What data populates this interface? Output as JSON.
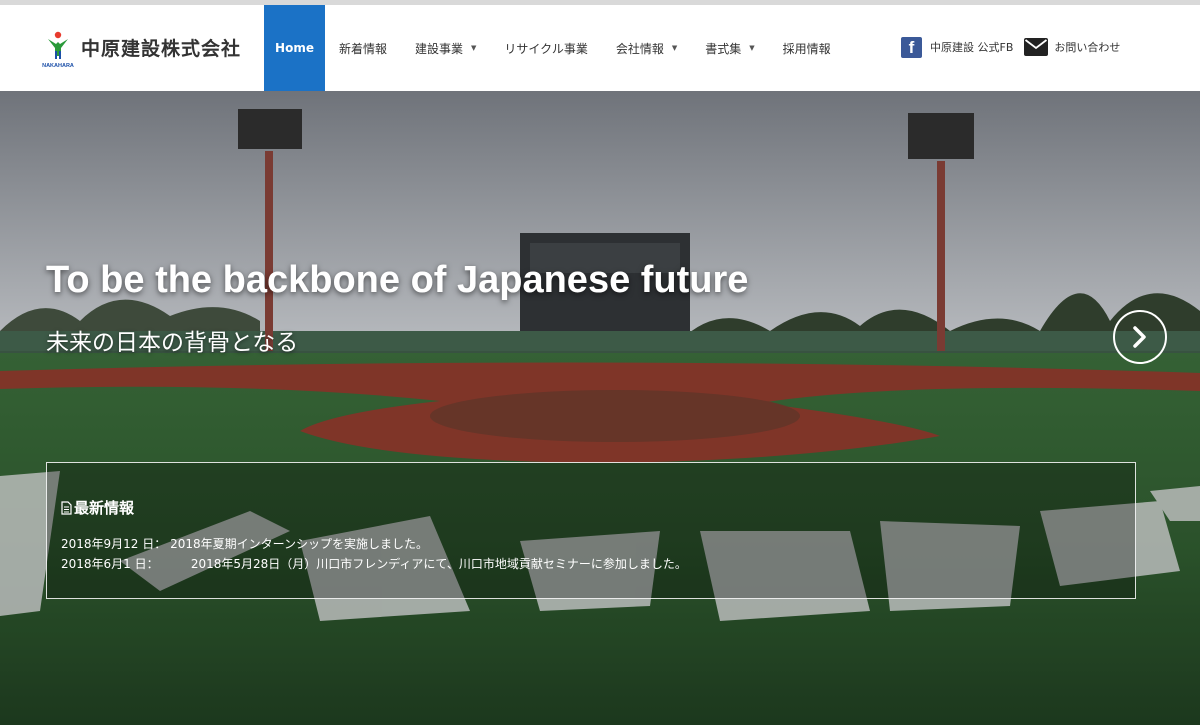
{
  "header": {
    "logo_text": "中原建設株式会社",
    "logo_sub": "NAKAHARA"
  },
  "nav": {
    "items": [
      {
        "label": "Home",
        "active": true,
        "has_dropdown": false
      },
      {
        "label": "新着情報",
        "has_dropdown": false
      },
      {
        "label": "建設事業",
        "has_dropdown": true
      },
      {
        "label": "リサイクル事業",
        "has_dropdown": false
      },
      {
        "label": "会社情報",
        "has_dropdown": true
      },
      {
        "label": "書式集",
        "has_dropdown": true
      },
      {
        "label": "採用情報",
        "has_dropdown": false
      }
    ]
  },
  "social": {
    "facebook_label": "中原建設 公式FB",
    "contact_label": "お問い合わせ",
    "facebook_color": "#3b5998"
  },
  "hero": {
    "title": "To be the backbone of Japanese future",
    "subtitle": "未来の日本の背骨となる"
  },
  "news": {
    "heading": "最新情報",
    "items": [
      {
        "date": "2018年9月12 日：",
        "text": "2018年夏期インターンシップを実施しました。"
      },
      {
        "date": "2018年6月1 日：",
        "text": "2018年5月28日（月）川口市フレンディアにて、川口市地域貢献セミナーに参加しました。"
      }
    ]
  },
  "colors": {
    "accent": "#1b72c6",
    "text": "#333333"
  }
}
